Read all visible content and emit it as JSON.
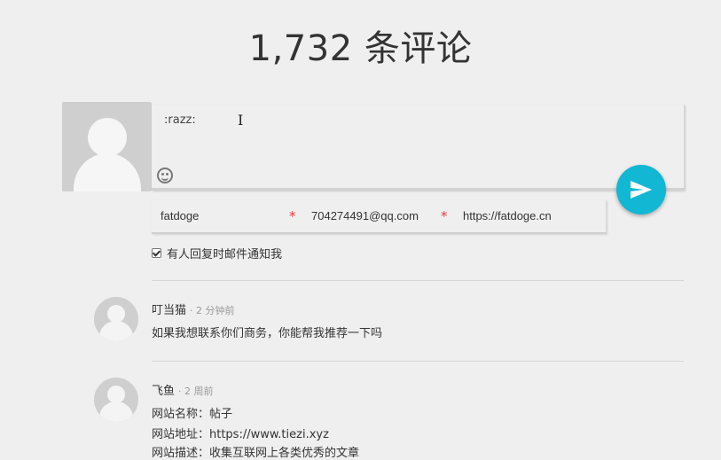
{
  "header": {
    "title": "1,732 条评论"
  },
  "editor": {
    "text": ":razz:",
    "caret": "I"
  },
  "fields": {
    "name": "fatdoge",
    "email": "704274491@qq.com",
    "website": "https://fatdoge.cn",
    "required_mark": "*"
  },
  "notify": {
    "label": "有人回复时邮件通知我",
    "checked": true
  },
  "comments": [
    {
      "author": "叮当猫",
      "time": "· 2 分钟前",
      "lines": [
        "如果我想联系你们商务，你能帮我推荐一下吗"
      ]
    },
    {
      "author": "飞鱼",
      "time": "· 2 周前",
      "lines": [
        "网站名称：帖子",
        "网站地址：https://www.tiezi.xyz",
        "网站描述：收集互联网上各类优秀的文章"
      ]
    }
  ],
  "colors": {
    "accent": "#12b7d4",
    "required": "#e53935",
    "background": "#efefef"
  },
  "icons": {
    "send": "send-icon",
    "emoji": "emoji-icon",
    "avatar": "default-avatar-icon"
  }
}
